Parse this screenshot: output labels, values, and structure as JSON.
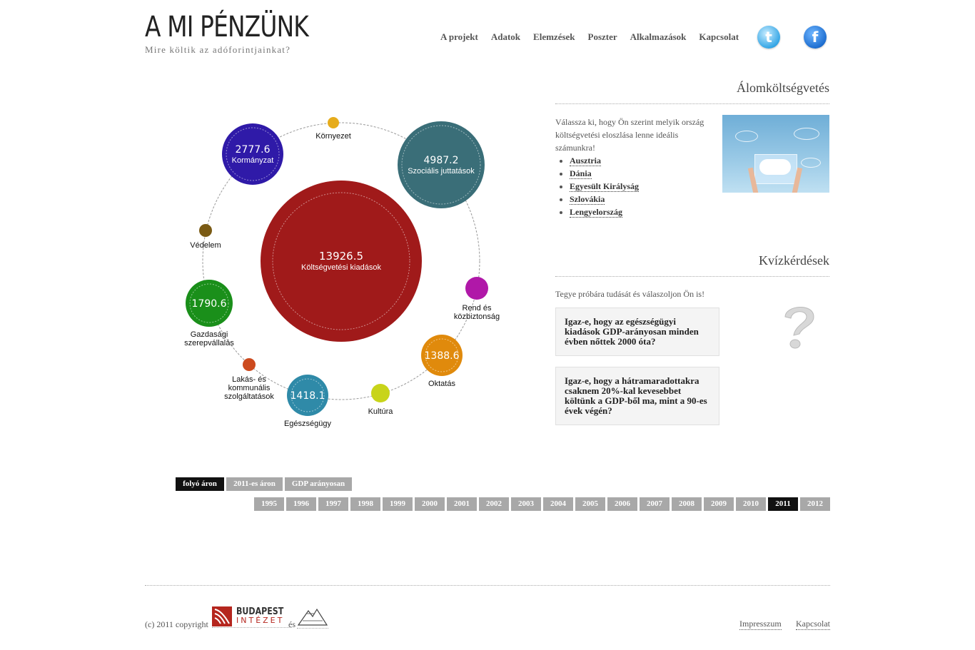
{
  "header": {
    "logo_title": "A MI PÉNZÜNK",
    "logo_subtitle": "Mire költik az adóforintjainkat?",
    "nav": [
      "A projekt",
      "Adatok",
      "Elemzések",
      "Poszter",
      "Alkalmazások",
      "Kapcsolat"
    ],
    "twitter_icon": "twitter-icon",
    "facebook_icon": "facebook-icon",
    "twitter_glyph": "t",
    "facebook_glyph": "f"
  },
  "chart": {
    "center": {
      "value": "13926.5",
      "label": "Költségvetési kiadások",
      "color": "#a01a1a"
    },
    "bubbles": [
      {
        "id": "kormanyzat",
        "value": "2777.6",
        "label": "Kormányzat",
        "color": "#2f1aa8"
      },
      {
        "id": "kornyezet",
        "value": "",
        "label": "Környezet",
        "color": "#e6ac1c"
      },
      {
        "id": "szocialis",
        "value": "4987.2",
        "label": "Szociális juttatások",
        "color": "#3a6e78"
      },
      {
        "id": "vedelem",
        "value": "",
        "label": "Védelem",
        "color": "#7a5a14"
      },
      {
        "id": "rend",
        "value": "",
        "label": "Rend és\nközbiztonság",
        "color": "#b018a8"
      },
      {
        "id": "gazdasagi",
        "value": "1790.6",
        "label": "Gazdasági\nszerepvállalás",
        "color": "#1a8f1a"
      },
      {
        "id": "oktatas",
        "value": "1388.6",
        "label": "Oktatás",
        "color": "#e08a0c"
      },
      {
        "id": "lakas",
        "value": "",
        "label": "Lakás- és\nkommunális\nszolgáltatások",
        "color": "#cc4a1e"
      },
      {
        "id": "kultura",
        "value": "",
        "label": "Kultúra",
        "color": "#c8d41a"
      },
      {
        "id": "egeszseg",
        "value": "1418.1",
        "label": "Egészségügy",
        "color": "#2f8aa8"
      }
    ]
  },
  "dream_budget": {
    "title": "Álomköltségvetés",
    "intro": "Válassza ki, hogy Ön szerint melyik ország költségvetési eloszlása lenne ideális számunkra!",
    "countries": [
      "Ausztria",
      "Dánia",
      "Egyesült Királyság",
      "Szlovákia",
      "Lengyelország"
    ]
  },
  "quiz": {
    "title": "Kvízkérdések",
    "intro": "Tegye próbára tudását és válaszoljon Ön is!",
    "questions": [
      "Igaz-e, hogy az egészségügyi kiadások GDP-arányosan minden évben nőttek 2000 óta?",
      "Igaz-e, hogy a hátramaradottakra csaknem 20%-kal kevesebbet költünk a GDP-ből ma, mint a 90-es évek végén?"
    ],
    "question_icon": "question-mark-icon"
  },
  "price_modes": [
    {
      "label": "folyó áron",
      "active": true
    },
    {
      "label": "2011-es áron",
      "active": false
    },
    {
      "label": "GDP arányosan",
      "active": false
    }
  ],
  "years": [
    "1995",
    "1996",
    "1997",
    "1998",
    "1999",
    "2000",
    "2001",
    "2002",
    "2003",
    "2004",
    "2005",
    "2006",
    "2007",
    "2008",
    "2009",
    "2010",
    "2011",
    "2012"
  ],
  "selected_year": "2011",
  "footer": {
    "copyright": "(c) 2011 copyright",
    "and": "és",
    "budapest_line1": "BUDAPEST",
    "budapest_line2": "INTÉZET",
    "links": [
      "Impresszum",
      "Kapcsolat"
    ]
  }
}
